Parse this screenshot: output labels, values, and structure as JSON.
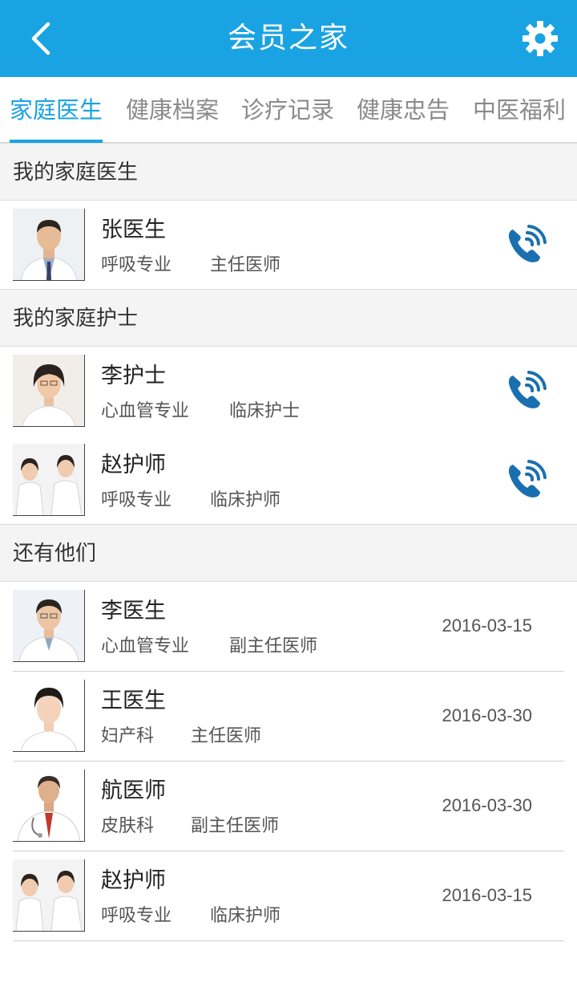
{
  "header": {
    "title": "会员之家"
  },
  "tabs": [
    {
      "label": "家庭医生",
      "active": true
    },
    {
      "label": "健康档案",
      "active": false
    },
    {
      "label": "诊疗记录",
      "active": false
    },
    {
      "label": "健康忠告",
      "active": false
    },
    {
      "label": "中医福利",
      "active": false
    }
  ],
  "sections": {
    "doctor": {
      "title": "我的家庭医生",
      "items": [
        {
          "name": "张医生",
          "specialty": "呼吸专业",
          "title": "主任医师"
        }
      ]
    },
    "nurse": {
      "title": "我的家庭护士",
      "items": [
        {
          "name": "李护士",
          "specialty": "心血管专业",
          "title": "临床护士"
        },
        {
          "name": "赵护师",
          "specialty": "呼吸专业",
          "title": "临床护师"
        }
      ]
    },
    "others": {
      "title": "还有他们",
      "items": [
        {
          "name": "李医生",
          "specialty": "心血管专业",
          "title": "副主任医师",
          "date": "2016-03-15"
        },
        {
          "name": "王医生",
          "specialty": "妇产科",
          "title": "主任医师",
          "date": "2016-03-30"
        },
        {
          "name": "航医师",
          "specialty": "皮肤科",
          "title": "副主任医师",
          "date": "2016-03-30"
        },
        {
          "name": "赵护师",
          "specialty": "呼吸专业",
          "title": "临床护师",
          "date": "2016-03-15"
        }
      ]
    }
  },
  "icons": {
    "back": "chevron-left-icon",
    "settings": "gear-icon",
    "phone": "phone-icon"
  },
  "colors": {
    "primary": "#1aa3e2",
    "phone_icon": "#1a6fb0"
  }
}
